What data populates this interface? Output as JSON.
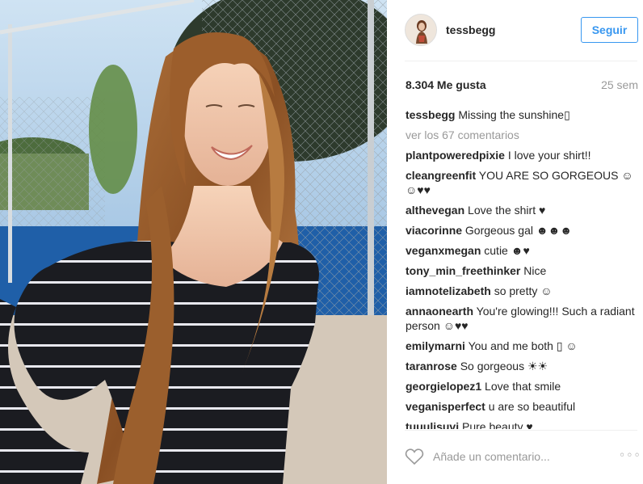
{
  "post": {
    "username": "tessbegg",
    "follow_label": "Seguir",
    "likes": "8.304 Me gusta",
    "time_ago": "25 sem",
    "caption_user": "tessbegg",
    "caption_text": "Missing the sunshine▯",
    "view_all": "ver los 67 comentarios"
  },
  "comments": [
    {
      "user": "plantpoweredpixie",
      "text": "I love your shirt!!"
    },
    {
      "user": "cleangreenfit",
      "text": "YOU ARE SO GORGEOUS ☺☺♥♥"
    },
    {
      "user": "althevegan",
      "text": "Love the shirt ♥"
    },
    {
      "user": "viacorinne",
      "text": "Gorgeous gal ☻☻☻"
    },
    {
      "user": "veganxmegan",
      "text": "cutie ☻♥"
    },
    {
      "user": "tony_min_freethinker",
      "text": "Nice"
    },
    {
      "user": "iamnotelizabeth",
      "text": "so pretty ☺"
    },
    {
      "user": "annaonearth",
      "text": "You're glowing!!! Such a radiant person ☺♥♥"
    },
    {
      "user": "emilymarni",
      "text": "You and me both ▯ ☺"
    },
    {
      "user": "taranrose",
      "text": "So gorgeous ☀☀"
    },
    {
      "user": "georgielopez1",
      "text": "Love that smile"
    },
    {
      "user": "veganisperfect",
      "text": "u are so beautiful"
    },
    {
      "user": "tuuulisuvi",
      "text": "Pure beauty ♥"
    }
  ],
  "footer": {
    "comment_placeholder": "Añade un comentario...",
    "more_label": "◦◦◦"
  },
  "colors": {
    "accent": "#3897f0",
    "muted": "#999999",
    "text": "#262626"
  },
  "icons": {
    "like": "heart-icon",
    "more": "ellipsis-icon"
  }
}
